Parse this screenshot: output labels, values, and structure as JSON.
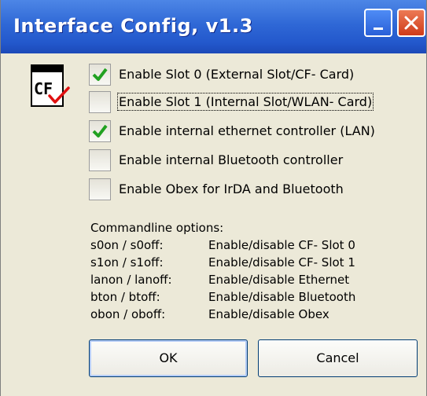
{
  "window": {
    "title": "Interface Config, v1.3"
  },
  "icon": {
    "text": "CF"
  },
  "options": [
    {
      "label": "Enable Slot 0 (External Slot/CF- Card)",
      "checked": true
    },
    {
      "label": "Enable Slot 1 (Internal Slot/WLAN- Card)",
      "checked": false
    },
    {
      "label": "Enable internal ethernet controller (LAN)",
      "checked": true
    },
    {
      "label": "Enable internal Bluetooth controller",
      "checked": false
    },
    {
      "label": "Enable Obex for IrDA and Bluetooth",
      "checked": false
    }
  ],
  "commandline": {
    "heading": "Commandline options:",
    "rows": [
      {
        "option": "s0on / s0off:",
        "description": "Enable/disable CF- Slot 0"
      },
      {
        "option": "s1on / s1off:",
        "description": "Enable/disable CF- Slot 1"
      },
      {
        "option": "lanon / lanoff:",
        "description": "Enable/disable Ethernet"
      },
      {
        "option": "bton / btoff:",
        "description": "Enable/disable Bluetooth"
      },
      {
        "option": "obon / oboff:",
        "description": "Enable/disable Obex"
      }
    ]
  },
  "buttons": {
    "ok": "OK",
    "cancel": "Cancel"
  },
  "colors": {
    "titlebar": "#2358cc",
    "check": "#21a121",
    "close": "#cf3b1a"
  }
}
